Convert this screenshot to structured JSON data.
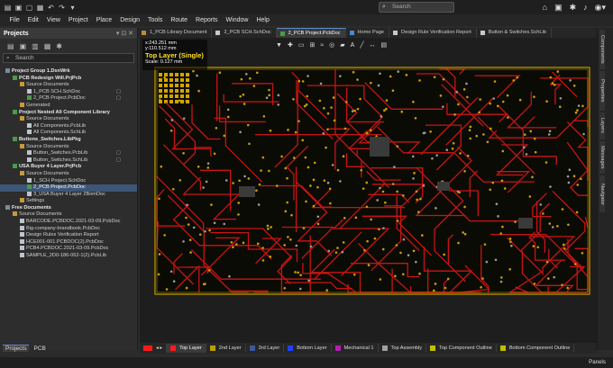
{
  "search": {
    "placeholder": "Search"
  },
  "menu": [
    "File",
    "Edit",
    "View",
    "Project",
    "Place",
    "Design",
    "Tools",
    "Route",
    "Reports",
    "Window",
    "Help"
  ],
  "projects_panel": {
    "title": "Projects",
    "search_placeholder": "Search",
    "tree": [
      {
        "label": "Project Group 1.DsnWrk",
        "bold": true,
        "icon": "grp",
        "indent": 0
      },
      {
        "label": "PCB Redesign Will.PrjPcb",
        "bold": true,
        "icon": "pcb",
        "indent": 1
      },
      {
        "label": "Source Documents",
        "bold": false,
        "icon": "fold",
        "indent": 2
      },
      {
        "label": "1_PCB SCH.SchDoc",
        "bold": false,
        "icon": "doc",
        "indent": 3,
        "mark": "▢"
      },
      {
        "label": "2_PCB Project.PcbDoc",
        "bold": false,
        "icon": "pcb",
        "indent": 3,
        "mark": "▢"
      },
      {
        "label": "Generated",
        "bold": false,
        "icon": "fold",
        "indent": 2
      },
      {
        "label": "Project Nested All Component Library",
        "bold": true,
        "icon": "pcb",
        "indent": 1
      },
      {
        "label": "Source Documents",
        "bold": false,
        "icon": "fold",
        "indent": 2
      },
      {
        "label": "All Components.PcbLib",
        "bold": false,
        "icon": "doc",
        "indent": 3
      },
      {
        "label": "All Components.SchLib",
        "bold": false,
        "icon": "doc",
        "indent": 3
      },
      {
        "label": "Buttons_Switches.LibPkg",
        "bold": true,
        "icon": "pcb",
        "indent": 1
      },
      {
        "label": "Source Documents",
        "bold": false,
        "icon": "fold",
        "indent": 2
      },
      {
        "label": "Button_Switches.PcbLib",
        "bold": false,
        "icon": "doc",
        "indent": 3,
        "mark": "▢"
      },
      {
        "label": "Button_Switches.SchLib",
        "bold": false,
        "icon": "doc",
        "indent": 3,
        "mark": "▢"
      },
      {
        "label": "USA Buyer 4 Layer.PrjPcb",
        "bold": true,
        "icon": "pcb",
        "indent": 1
      },
      {
        "label": "Source Documents",
        "bold": false,
        "icon": "fold",
        "indent": 2
      },
      {
        "label": "1_SCH Project.SchDoc",
        "bold": false,
        "icon": "doc",
        "indent": 3
      },
      {
        "label": "2_PCB Project.PcbDoc",
        "bold": false,
        "icon": "pcb",
        "indent": 3,
        "selected": true
      },
      {
        "label": "3_USA Buyer 4 Layer 2BomDoc",
        "bold": false,
        "icon": "doc",
        "indent": 3
      },
      {
        "label": "Settings",
        "bold": false,
        "icon": "fold",
        "indent": 2
      },
      {
        "label": "Free Documents",
        "bold": true,
        "icon": "grp",
        "indent": 0
      },
      {
        "label": "Source Documents",
        "bold": false,
        "icon": "fold",
        "indent": 1
      },
      {
        "label": "BARCODE.PCBDOC.2021-03-09.PcbDoc",
        "bold": false,
        "icon": "doc",
        "indent": 2
      },
      {
        "label": "Big-company-brandbook.PcbDoc",
        "bold": false,
        "icon": "doc",
        "indent": 2
      },
      {
        "label": "Design Rules Verification Report",
        "bold": false,
        "icon": "doc",
        "indent": 2
      },
      {
        "label": "HCE001-001.PCBDOC(2).PcbDoc",
        "bold": false,
        "icon": "doc",
        "indent": 2
      },
      {
        "label": "PCB4.PCBDOC.2021-03-09.PcbDoc",
        "bold": false,
        "icon": "doc",
        "indent": 2
      },
      {
        "label": "SAMPLE_2D0-186-062-1(2).PcbLib",
        "bold": false,
        "icon": "doc",
        "indent": 2
      }
    ]
  },
  "left_tabs": [
    "Projects",
    "PCB"
  ],
  "doc_tabs": [
    {
      "label": "1_PCB Library Document",
      "active": false,
      "color": "#c08a3a"
    },
    {
      "label": "2_PCB SCH.SchDoc",
      "active": false,
      "color": "#c8c8c8"
    },
    {
      "label": "2_PCB Project.PcbDoc",
      "active": true,
      "color": "#4a9a4a"
    },
    {
      "label": "Home Page",
      "active": false,
      "color": "#4a8ad0"
    },
    {
      "label": "Design Rule Verification Report",
      "active": false,
      "color": "#c8c8c8"
    },
    {
      "label": "Button & Switches.SchLib",
      "active": false,
      "color": "#c8c8c8"
    }
  ],
  "hud": {
    "x": "x:243.251 mm",
    "y": "y:110.512 mm",
    "layer": "Top Layer (Single)",
    "scale": "Scale: 0.127 mm"
  },
  "right_tabs": [
    "Components",
    "Properties",
    "Layers",
    "Messages",
    "Navigator"
  ],
  "layers": [
    {
      "label": "Top Layer",
      "color": "#ff1a1a",
      "active": true
    },
    {
      "label": "2nd Layer",
      "color": "#b8a000",
      "active": false
    },
    {
      "label": "3rd Layer",
      "color": "#3a5aa0",
      "active": false
    },
    {
      "label": "Bottom Layer",
      "color": "#2040ff",
      "active": false
    },
    {
      "label": "Mechanical 1",
      "color": "#b020b0",
      "active": false
    },
    {
      "label": "Top Assembly",
      "color": "#a0a0a0",
      "active": false
    },
    {
      "label": "Top Component Outline",
      "color": "#c0c000",
      "active": false
    },
    {
      "label": "Bottom Component Outline",
      "color": "#c0c000",
      "active": false
    }
  ],
  "status": {
    "panels": "Panels"
  }
}
